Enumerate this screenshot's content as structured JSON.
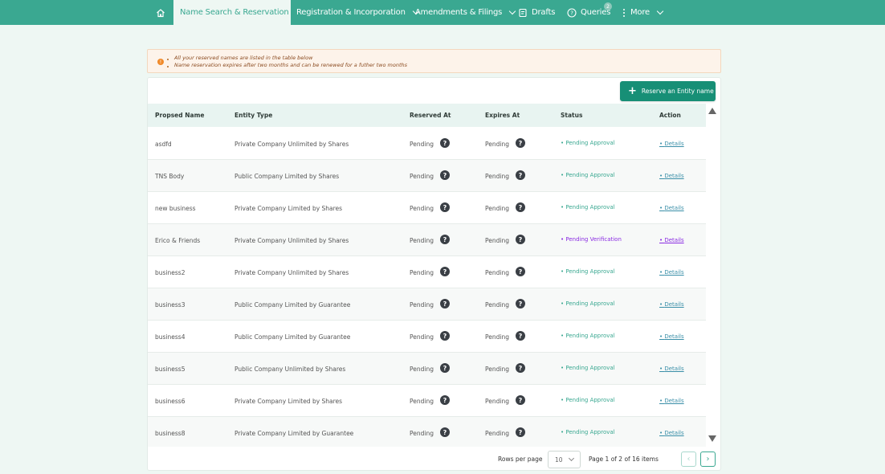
{
  "nav": {
    "home_icon": "home-icon",
    "items": [
      {
        "label": "Name Search & Reservation",
        "active": true,
        "has_chevron": true
      },
      {
        "label": "Registration & Incorporation",
        "active": false,
        "has_chevron": true
      },
      {
        "label": "Amendments & Filings",
        "active": false,
        "has_chevron": true
      },
      {
        "label": "Drafts",
        "icon": "drafts-icon"
      },
      {
        "label": "Queries",
        "icon": "help-circle-icon",
        "badge": "2"
      },
      {
        "label": "More",
        "icon": "vertical-dots-icon",
        "has_chevron": true
      }
    ],
    "colors": {
      "bar": "#3aa891",
      "active_bg": "#eef7f3"
    }
  },
  "banner": {
    "lines": [
      "All your reserved names are listed in the table below",
      "Name reservation expires after two months and can be renewed for a futher two months"
    ],
    "icon": "info-icon"
  },
  "reserve_button": {
    "label": "Reserve an Entity name",
    "icon": "plus-icon"
  },
  "table": {
    "headers": [
      "Propsed Name",
      "Entity Type",
      "Reserved At",
      "Expires At",
      "Status",
      "Action"
    ],
    "rows": [
      {
        "name": "asdfd",
        "entity_type": "Private Company Unlimited by Shares",
        "reserved": "Pending",
        "expires": "Pending",
        "status": "Pending Approval",
        "action": "Details"
      },
      {
        "name": "TNS Body",
        "entity_type": "Public Company Limited by Shares",
        "reserved": "Pending",
        "expires": "Pending",
        "status": "Pending Approval",
        "action": "Details"
      },
      {
        "name": "new business",
        "entity_type": "Private Company Limited by Shares",
        "reserved": "Pending",
        "expires": "Pending",
        "status": "Pending Approval",
        "action": "Details"
      },
      {
        "name": "Erico & Friends",
        "entity_type": "Private Company Unlimited by Shares",
        "reserved": "Pending",
        "expires": "Pending",
        "status": "Pending Verification",
        "action": "Details"
      },
      {
        "name": "business2",
        "entity_type": "Private Company Unlimited by Shares",
        "reserved": "Pending",
        "expires": "Pending",
        "status": "Pending Approval",
        "action": "Details"
      },
      {
        "name": "business3",
        "entity_type": "Public Company Limited by Guarantee",
        "reserved": "Pending",
        "expires": "Pending",
        "status": "Pending Approval",
        "action": "Details"
      },
      {
        "name": "business4",
        "entity_type": "Public Company Limited by Guarantee",
        "reserved": "Pending",
        "expires": "Pending",
        "status": "Pending Approval",
        "action": "Details"
      },
      {
        "name": "business5",
        "entity_type": "Public Company Unlimited by Shares",
        "reserved": "Pending",
        "expires": "Pending",
        "status": "Pending Approval",
        "action": "Details"
      },
      {
        "name": "business6",
        "entity_type": "Private Company Limited by Shares",
        "reserved": "Pending",
        "expires": "Pending",
        "status": "Pending Approval",
        "action": "Details"
      },
      {
        "name": "business8",
        "entity_type": "Private Company Limited by Guarantee",
        "reserved": "Pending",
        "expires": "Pending",
        "status": "Pending Approval",
        "action": "Details"
      }
    ],
    "help_icon": "question-circle-icon",
    "status_colors": {
      "approval": "#3aa891",
      "verification": "#8a2be2"
    }
  },
  "pagination": {
    "rows_per_page_label": "Rows per page",
    "rows_per_page_value": "10",
    "page_info": "Page 1 of 2 of 16 items",
    "prev_icon": "chevron-left-icon",
    "next_icon": "chevron-right-icon"
  }
}
